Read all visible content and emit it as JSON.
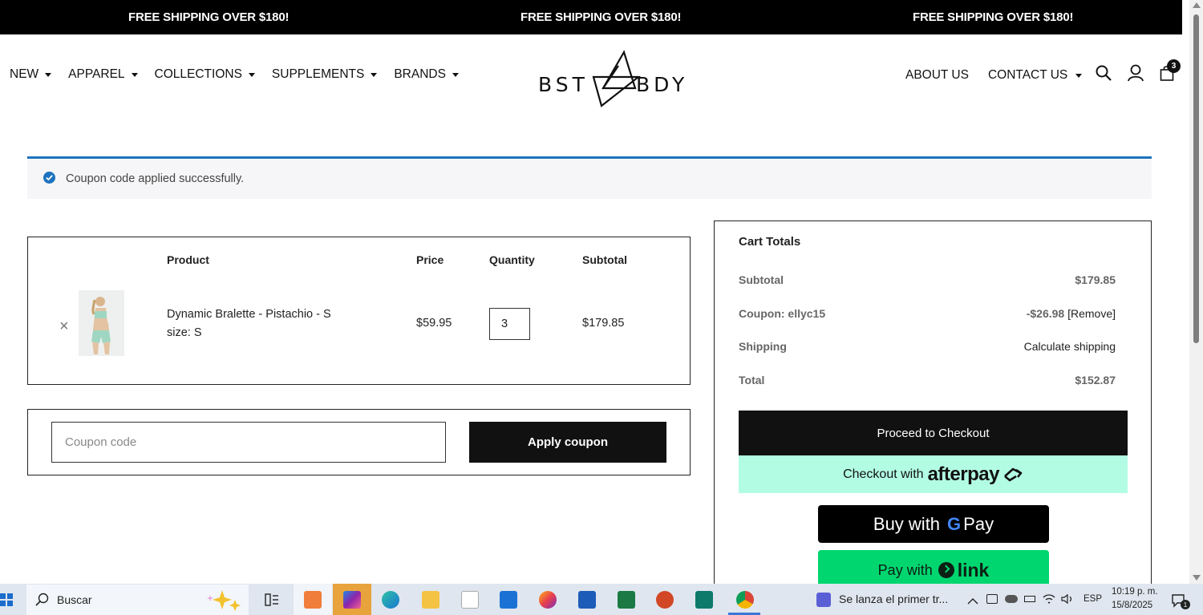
{
  "announcement": {
    "items": [
      "FREE SHIPPING OVER $180!",
      "FREE SHIPPING OVER $180!",
      "FREE SHIPPING OVER $180!"
    ]
  },
  "header": {
    "nav_left": [
      "NEW",
      "APPAREL",
      "COLLECTIONS",
      "SUPPLEMENTS",
      "BRANDS"
    ],
    "nav_right": [
      "ABOUT US",
      "CONTACT US"
    ],
    "logo_text_left": "BST",
    "logo_text_right": "BDY",
    "cart_count": "3"
  },
  "notice": {
    "message": "Coupon code applied successfully."
  },
  "cart_table": {
    "headers": {
      "product": "Product",
      "price": "Price",
      "quantity": "Quantity",
      "subtotal": "Subtotal"
    },
    "item": {
      "remove_symbol": "×",
      "name": "Dynamic Bralette - Pistachio - S",
      "size": "size: S",
      "price": "$59.95",
      "quantity": "3",
      "subtotal": "$179.85"
    }
  },
  "coupon": {
    "placeholder": "Coupon code",
    "apply_label": "Apply coupon"
  },
  "totals": {
    "title": "Cart Totals",
    "subtotal_label": "Subtotal",
    "subtotal_value": "$179.85",
    "coupon_label": "Coupon: ellyc15",
    "coupon_value": "-$26.98",
    "coupon_remove": "[Remove]",
    "shipping_label": "Shipping",
    "shipping_value": "Calculate shipping",
    "total_label": "Total",
    "total_value": "$152.87",
    "checkout_label": "Proceed to Checkout",
    "afterpay_prefix": "Checkout with",
    "afterpay_brand": "afterpay",
    "gpay_prefix": "Buy with",
    "gpay_g": "G",
    "gpay_brand": "Pay",
    "link_prefix": "Pay with",
    "link_brand": "link"
  },
  "taskbar": {
    "search_label": "Buscar",
    "news_text": "Se lanza el primer tr...",
    "language": "ESP",
    "time": "10:19 p. m.",
    "date": "15/8/2025",
    "notification_count": "1"
  },
  "colors": {
    "announcement_bg": "#000000",
    "notice_accent": "#1e73be",
    "afterpay_bg": "#b2fce4",
    "link_bg": "#00d66f",
    "taskbar_bg": "#dfe6ef"
  }
}
